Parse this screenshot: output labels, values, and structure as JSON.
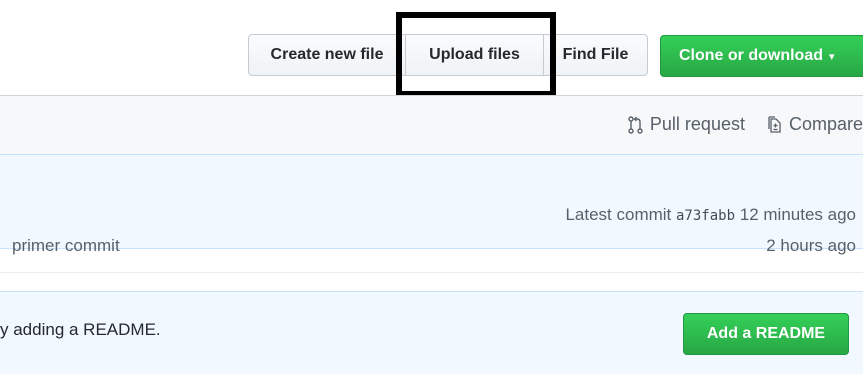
{
  "toolbar": {
    "create_new_file": "Create new file",
    "upload_files": "Upload files",
    "find_file": "Find File",
    "clone_or_download": "Clone or download",
    "clone_caret": "▾"
  },
  "links_bar": {
    "pull_request": "Pull request",
    "compare": "Compare"
  },
  "commit_bar": {
    "label": "Latest commit",
    "sha": "a73fabb",
    "age": "12 minutes ago"
  },
  "file_row": {
    "message": "primer commit",
    "age": "2 hours ago"
  },
  "readme_banner": {
    "text": "y adding a README.",
    "button": "Add a README"
  },
  "icons": {
    "pull_request": "git-pull-request-icon",
    "compare": "diff-icon"
  },
  "colors": {
    "green": "#28a745",
    "highlight_border": "#000000",
    "blue_bg": "#f1f8ff"
  }
}
